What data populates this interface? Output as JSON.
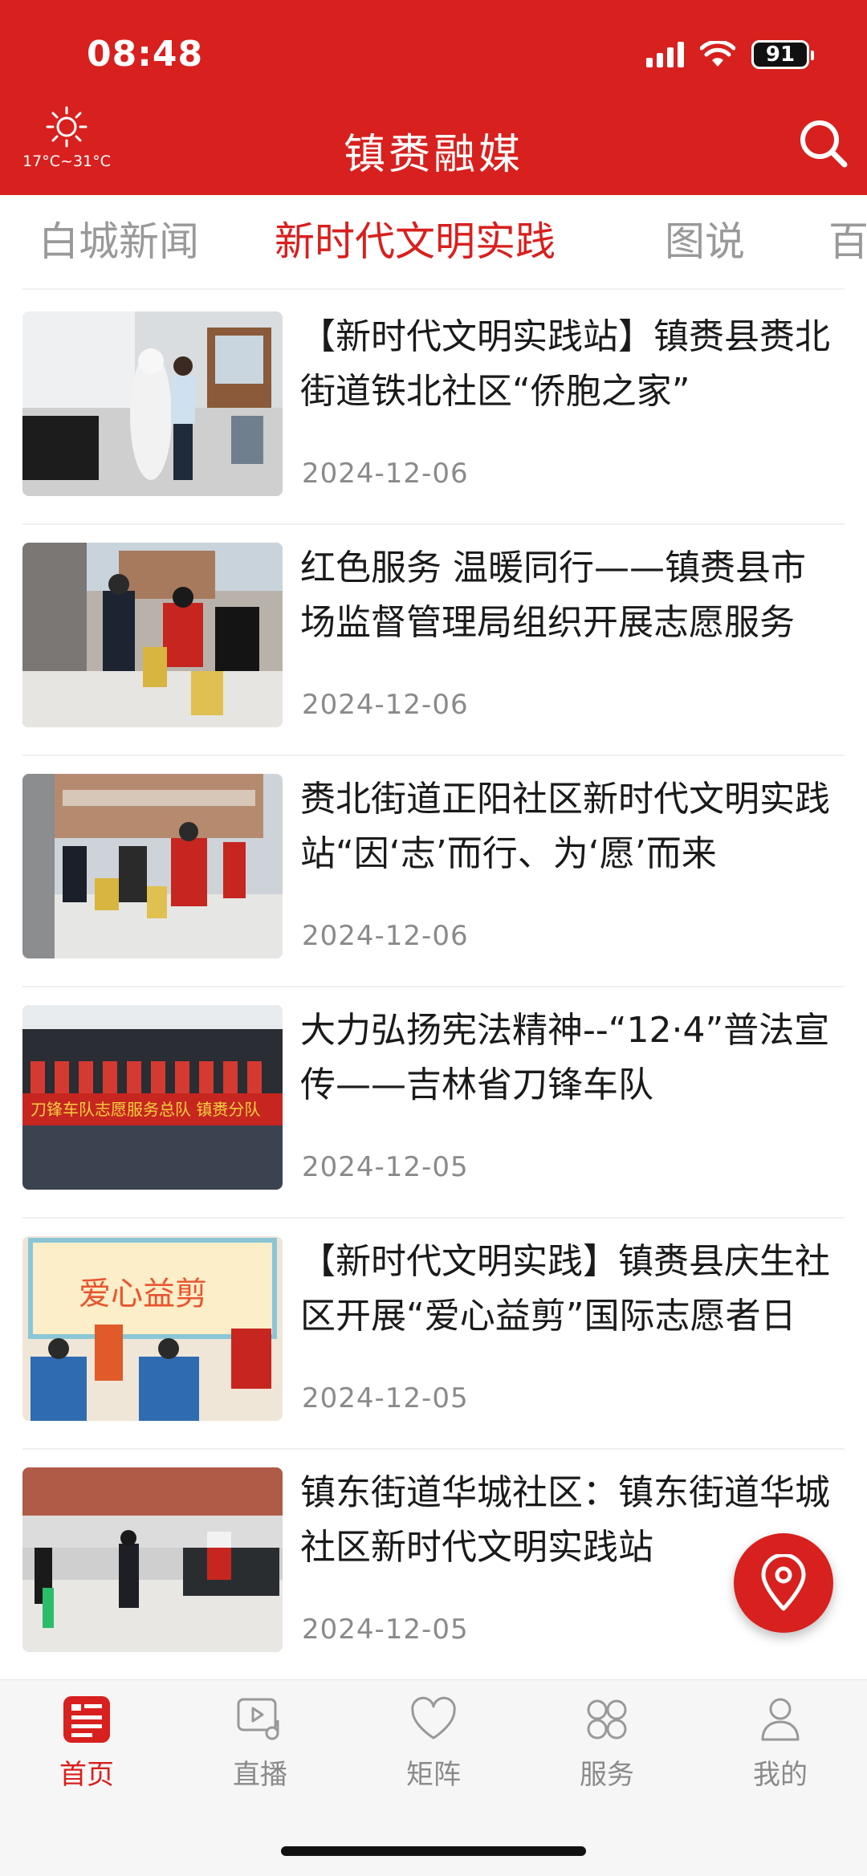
{
  "status_bar": {
    "time": "08:48",
    "battery": "91"
  },
  "header": {
    "weather_temp": "17°C~31°C",
    "title": "镇赉融媒"
  },
  "tabs": [
    {
      "label": "白城新闻",
      "active": false
    },
    {
      "label": "新时代文明实践",
      "active": true
    },
    {
      "label": "图说",
      "active": false
    },
    {
      "label": "百",
      "active": false
    }
  ],
  "news": [
    {
      "title": "【新时代文明实践站】镇赉县赉北街道铁北社区“侨胞之家”",
      "date": "2024-12-06"
    },
    {
      "title": "红色服务 温暖同行——镇赉县市场监督管理局组织开展志愿服务",
      "date": "2024-12-06"
    },
    {
      "title": "赉北街道正阳社区新时代文明实践站“因‘志’而行、为‘愿’而来",
      "date": "2024-12-06"
    },
    {
      "title": "大力弘扬宪法精神--“12·4”普法宣传——吉林省刀锋车队",
      "date": "2024-12-05"
    },
    {
      "title": "【新时代文明实践】镇赉县庆生社区开展“爱心益剪”国际志愿者日",
      "date": "2024-12-05"
    },
    {
      "title": "镇东街道华城社区：镇东街道华城社区新时代文明实践站",
      "date": "2024-12-05"
    }
  ],
  "thumb_captions": {
    "banner_4": "刀锋车队志愿服务总队  镇赉分队",
    "banner_5": "爱心益剪"
  },
  "bottom_nav": [
    {
      "label": "首页",
      "icon": "news-icon",
      "active": true
    },
    {
      "label": "直播",
      "icon": "live-icon",
      "active": false
    },
    {
      "label": "矩阵",
      "icon": "heart-icon",
      "active": false
    },
    {
      "label": "服务",
      "icon": "services-icon",
      "active": false
    },
    {
      "label": "我的",
      "icon": "profile-icon",
      "active": false
    }
  ],
  "colors": {
    "brand_red": "#d8201e",
    "muted_gray": "#8a8a8a"
  }
}
